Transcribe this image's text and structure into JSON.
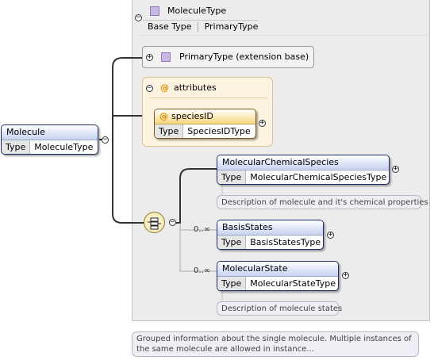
{
  "root": {
    "name": "Molecule",
    "type_key": "Type",
    "type_value": "MoleculeType"
  },
  "complex_type": {
    "name": "MoleculeType",
    "base_type_key": "Base Type",
    "base_type_value": "PrimaryType",
    "extension": "PrimaryType (extension base)"
  },
  "attributes": {
    "title": "attributes",
    "items": [
      {
        "name": "speciesID",
        "type_key": "Type",
        "type_value": "SpeciesIDType"
      }
    ]
  },
  "sequence": {
    "children": [
      {
        "name": "MolecularChemicalSpecies",
        "type_key": "Type",
        "type_value": "MolecularChemicalSpeciesType",
        "multiplicity": "",
        "doc": "Description of molecule and it's chemical properties"
      },
      {
        "name": "BasisStates",
        "type_key": "Type",
        "type_value": "BasisStatesType",
        "multiplicity": "0..∞",
        "doc": ""
      },
      {
        "name": "MolecularState",
        "type_key": "Type",
        "type_value": "MolecularStateType",
        "multiplicity": "0..∞",
        "doc": "Description of molecule states"
      }
    ]
  },
  "root_doc": [
    "Grouped information about the single molecule. Multiple instances of",
    "the same molecule are allowed in instance..."
  ],
  "colors": {
    "panel": "#ececec",
    "element_border": "#1c2a66",
    "attribute_border": "#7a5a14",
    "attribute_group_bg": "#fdf3e0",
    "type_square": "#c9b8e6"
  }
}
